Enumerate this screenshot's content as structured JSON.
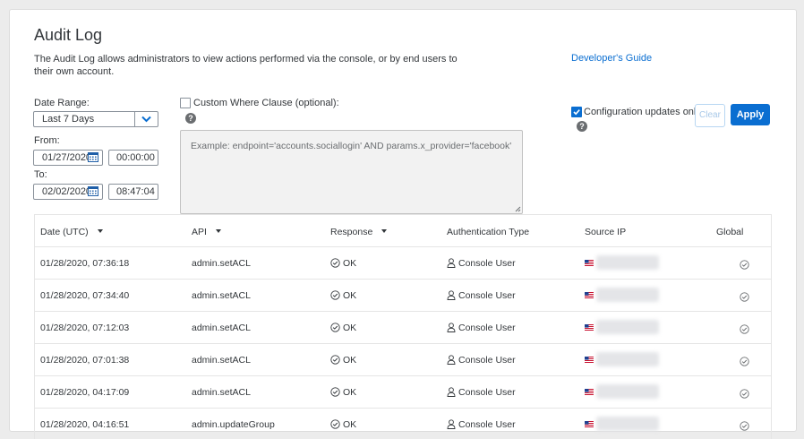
{
  "page": {
    "title": "Audit Log",
    "description": "The Audit Log allows administrators to view actions performed via the console, or by end users to their own account.",
    "developer_guide_link": "Developer's Guide"
  },
  "filters": {
    "date_range_label": "Date Range:",
    "date_range_value": "Last 7 Days",
    "from_label": "From:",
    "from_date": "01/27/2020",
    "from_time": "00:00:00",
    "to_label": "To:",
    "to_date": "02/02/2020",
    "to_time": "08:47:04",
    "custom_where_label": "Custom Where Clause (optional):",
    "custom_where_checked": false,
    "custom_where_placeholder": "Example: endpoint='accounts.sociallogin' AND params.x_provider='facebook'",
    "config_updates_label": "Configuration updates only",
    "config_updates_checked": true,
    "clear_label": "Clear",
    "apply_label": "Apply"
  },
  "table": {
    "columns": [
      "Date (UTC)",
      "API",
      "Response",
      "Authentication Type",
      "Source IP",
      "Global"
    ],
    "rows": [
      {
        "date": "01/28/2020, 07:36:18",
        "api": "admin.setACL",
        "response": "OK",
        "auth": "Console User"
      },
      {
        "date": "01/28/2020, 07:34:40",
        "api": "admin.setACL",
        "response": "OK",
        "auth": "Console User"
      },
      {
        "date": "01/28/2020, 07:12:03",
        "api": "admin.setACL",
        "response": "OK",
        "auth": "Console User"
      },
      {
        "date": "01/28/2020, 07:01:38",
        "api": "admin.setACL",
        "response": "OK",
        "auth": "Console User"
      },
      {
        "date": "01/28/2020, 04:17:09",
        "api": "admin.setACL",
        "response": "OK",
        "auth": "Console User"
      },
      {
        "date": "01/28/2020, 04:16:51",
        "api": "admin.updateGroup",
        "response": "OK",
        "auth": "Console User"
      }
    ]
  },
  "icons": {
    "dropdown": "chevron-down-icon",
    "calendar": "calendar-icon",
    "help": "question-icon",
    "checkmark": "check-icon",
    "ok_status": "check-circle-icon",
    "user": "user-icon",
    "flag": "us-flag-icon",
    "sort": "sort-down-icon"
  },
  "colors": {
    "accent": "#0a6ed1",
    "text": "#32363a",
    "border": "#89919a"
  }
}
